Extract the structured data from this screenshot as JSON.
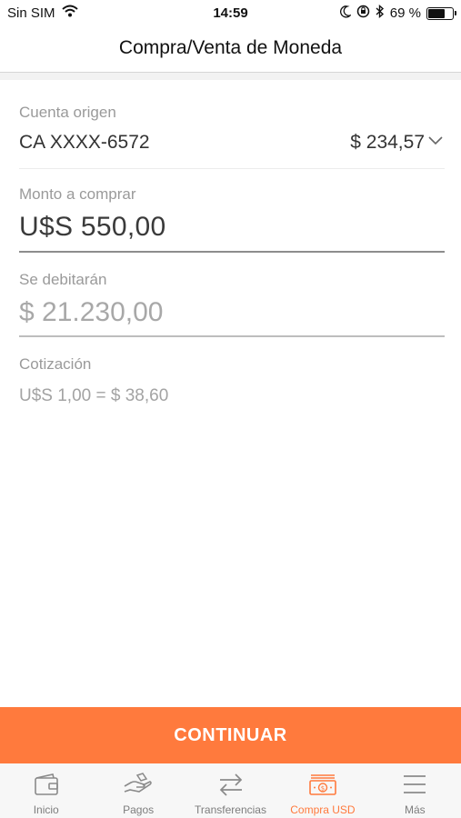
{
  "status_bar": {
    "carrier": "Sin SIM",
    "time": "14:59",
    "battery_text": "69 %",
    "battery_level": 0.69
  },
  "header": {
    "title": "Compra/Venta de Moneda"
  },
  "form": {
    "source_account": {
      "label": "Cuenta origen",
      "account": "CA XXXX-6572",
      "balance": "$ 234,57"
    },
    "amount_to_buy": {
      "label": "Monto a comprar",
      "value": "U$S 550,00"
    },
    "debit": {
      "label": "Se debitarán",
      "value": "$ 21.230,00"
    },
    "rate": {
      "label": "Cotización",
      "value": "U$S 1,00 = $ 38,60"
    }
  },
  "continue_label": "CONTINUAR",
  "tabs": [
    {
      "label": "Inicio",
      "icon": "wallet-icon"
    },
    {
      "label": "Pagos",
      "icon": "hand-payment-icon"
    },
    {
      "label": "Transferencias",
      "icon": "transfer-arrows-icon"
    },
    {
      "label": "Compra USD",
      "icon": "cash-icon",
      "active": true
    },
    {
      "label": "Más",
      "icon": "menu-icon"
    }
  ],
  "colors": {
    "accent": "#ff7a3d",
    "tab_inactive": "#7d7d7d"
  }
}
